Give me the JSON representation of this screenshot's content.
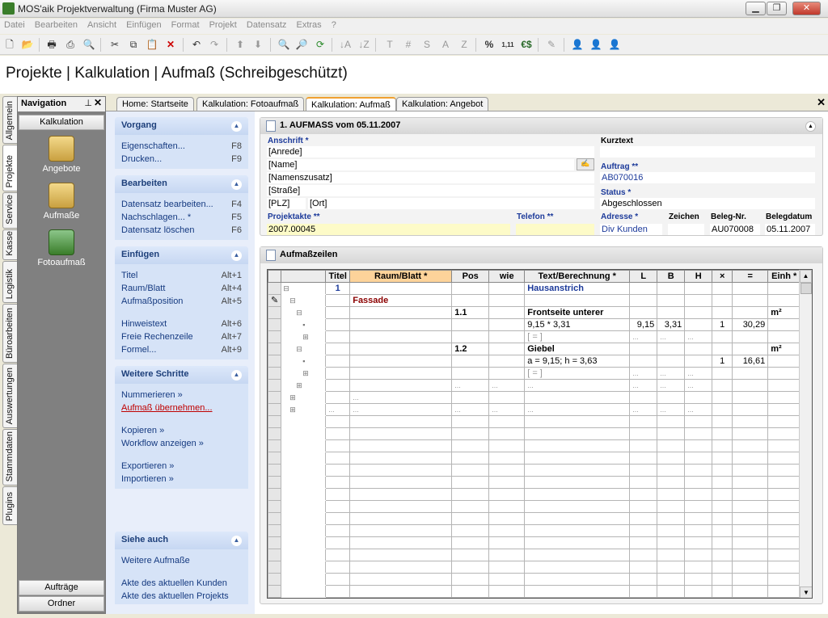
{
  "window": {
    "title": "MOS'aik Projektverwaltung (Firma Muster AG)"
  },
  "menu": [
    "Datei",
    "Bearbeiten",
    "Ansicht",
    "Einfügen",
    "Format",
    "Projekt",
    "Datensatz",
    "Extras",
    "?"
  ],
  "page_title": "Projekte | Kalkulation | Aufmaß (Schreibgeschützt)",
  "vertical_tabs": [
    "Allgemein",
    "Projekte",
    "Service",
    "Kasse",
    "Logistik",
    "Büroarbeiten",
    "Auswertungen",
    "Stammdaten",
    "Plugins"
  ],
  "navigation": {
    "title": "Navigation",
    "section": "Kalkulation",
    "items": [
      "Angebote",
      "Aufmaße",
      "Fotoaufmaß"
    ],
    "bottom": [
      "Aufträge",
      "Ordner"
    ]
  },
  "doc_tabs": [
    "Home: Startseite",
    "Kalkulation: Fotoaufmaß",
    "Kalkulation: Aufmaß",
    "Kalkulation: Angebot"
  ],
  "tasks": {
    "vorgang": {
      "title": "Vorgang",
      "items": [
        {
          "label": "Eigenschaften...",
          "key": "F8"
        },
        {
          "label": "Drucken...",
          "key": "F9"
        }
      ]
    },
    "bearbeiten": {
      "title": "Bearbeiten",
      "items": [
        {
          "label": "Datensatz bearbeiten...",
          "key": "F4"
        },
        {
          "label": "Nachschlagen... *",
          "key": "F5"
        },
        {
          "label": "Datensatz löschen",
          "key": "F6"
        }
      ]
    },
    "einfuegen": {
      "title": "Einfügen",
      "items": [
        {
          "label": "Titel",
          "key": "Alt+1"
        },
        {
          "label": "Raum/Blatt",
          "key": "Alt+4"
        },
        {
          "label": "Aufmaßposition",
          "key": "Alt+5"
        },
        {
          "label": "Hinweistext",
          "key": "Alt+6"
        },
        {
          "label": "Freie Rechenzeile",
          "key": "Alt+7"
        },
        {
          "label": "Formel...",
          "key": "Alt+9"
        }
      ]
    },
    "weitere": {
      "title": "Weitere Schritte",
      "items": [
        "Nummerieren »",
        "Aufmaß übernehmen...",
        "Kopieren »",
        "Workflow anzeigen »",
        "Exportieren »",
        "Importieren »"
      ]
    },
    "siehe": {
      "title": "Siehe auch",
      "items": [
        "Weitere Aufmaße",
        "Akte des aktuellen Kunden",
        "Akte des aktuellen Projekts"
      ]
    }
  },
  "header_panel": {
    "title": "1. AUFMASS vom 05.11.2007",
    "anschrift_label": "Anschrift *",
    "anrede": "[Anrede]",
    "name": "[Name]",
    "namenszusatz": "[Namenszusatz]",
    "strasse": "[Straße]",
    "plz": "[PLZ]",
    "ort": "[Ort]",
    "kurztext_label": "Kurztext",
    "kurztext": "",
    "auftrag_label": "Auftrag **",
    "auftrag": "AB070016",
    "status_label": "Status *",
    "status": "Abgeschlossen",
    "projektakte_label": "Projektakte **",
    "projektakte": "2007.00045",
    "telefon_label": "Telefon **",
    "telefon": "",
    "adresse_label": "Adresse *",
    "adresse": "Div Kunden",
    "zeichen_label": "Zeichen",
    "zeichen": "",
    "belegnr_label": "Beleg-Nr.",
    "belegnr": "AU070008",
    "belegdatum_label": "Belegdatum",
    "belegdatum": "05.11.2007"
  },
  "grid_panel": {
    "title": "Aufmaßzeilen",
    "columns": [
      "Titel",
      "Raum/Blatt *",
      "Pos",
      "wie",
      "Text/Berechnung *",
      "L",
      "B",
      "H",
      "×",
      "=",
      "Einh *"
    ],
    "rows": [
      {
        "titel": "1",
        "raum": "",
        "pos": "",
        "wie": "",
        "text": "Hausanstrich",
        "l": "",
        "b": "",
        "h": "",
        "x": "",
        "eq": "",
        "einh": ""
      },
      {
        "titel": "",
        "raum": "Fassade",
        "pos": "",
        "wie": "",
        "text": "",
        "l": "",
        "b": "",
        "h": "",
        "x": "",
        "eq": "",
        "einh": ""
      },
      {
        "titel": "",
        "raum": "",
        "pos": "1.1",
        "wie": "",
        "text": "Frontseite unterer",
        "l": "",
        "b": "",
        "h": "",
        "x": "",
        "eq": "",
        "einh": "m²"
      },
      {
        "titel": "",
        "raum": "",
        "pos": "",
        "wie": "",
        "text": "9,15 * 3,31",
        "l": "9,15",
        "b": "3,31",
        "h": "",
        "x": "1",
        "eq": "30,29",
        "einh": ""
      },
      {
        "titel": "",
        "raum": "",
        "pos": "",
        "wie": "",
        "text": "[ = ]",
        "l": "...",
        "b": "...",
        "h": "...",
        "x": "",
        "eq": "",
        "einh": ""
      },
      {
        "titel": "",
        "raum": "",
        "pos": "1.2",
        "wie": "",
        "text": "Giebel",
        "l": "",
        "b": "",
        "h": "",
        "x": "",
        "eq": "",
        "einh": "m²"
      },
      {
        "titel": "",
        "raum": "",
        "pos": "",
        "wie": "",
        "text": "a = 9,15; h = 3,63",
        "l": "",
        "b": "",
        "h": "",
        "x": "1",
        "eq": "16,61",
        "einh": ""
      },
      {
        "titel": "",
        "raum": "",
        "pos": "",
        "wie": "",
        "text": "[ = ]",
        "l": "...",
        "b": "...",
        "h": "...",
        "x": "",
        "eq": "",
        "einh": ""
      },
      {
        "titel": "",
        "raum": "",
        "pos": "...",
        "wie": "...",
        "text": "...",
        "l": "...",
        "b": "...",
        "h": "...",
        "x": "",
        "eq": "",
        "einh": ""
      },
      {
        "titel": "",
        "raum": "...",
        "pos": "",
        "wie": "",
        "text": "",
        "l": "",
        "b": "",
        "h": "",
        "x": "",
        "eq": "",
        "einh": ""
      },
      {
        "titel": "...",
        "raum": "...",
        "pos": "...",
        "wie": "...",
        "text": "...",
        "l": "...",
        "b": "...",
        "h": "...",
        "x": "",
        "eq": "",
        "einh": ""
      }
    ]
  },
  "colors": {
    "label_blue": "#1c3a9a",
    "task_bg": "#e8eefa",
    "yellow_field": "#fdfbc8",
    "red_text": "#8b0000"
  }
}
